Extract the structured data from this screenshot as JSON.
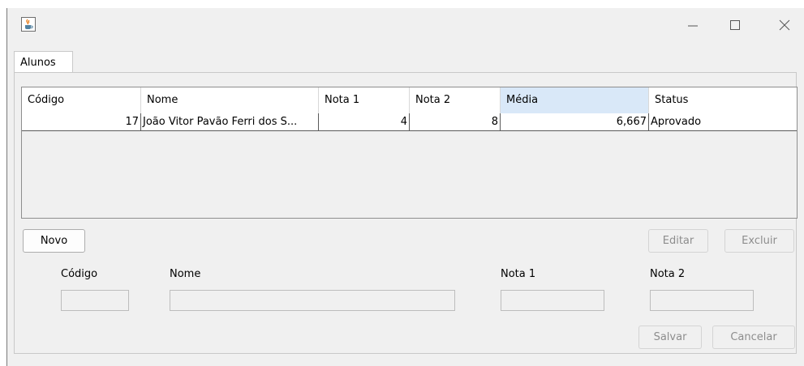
{
  "window": {
    "minimize_icon": "minimize-icon",
    "maximize_icon": "maximize-icon",
    "close_icon": "close-icon",
    "app_icon": "java-cup-icon"
  },
  "tabs": [
    {
      "label": "Alunos",
      "selected": true
    }
  ],
  "table": {
    "columns": [
      "Código",
      "Nome",
      "Nota 1",
      "Nota 2",
      "Média",
      "Status"
    ],
    "selected_column": "Média",
    "rows": [
      [
        "17",
        "João Vitor Pavão Ferri dos S...",
        "4",
        "8",
        "6,667",
        "Aprovado"
      ]
    ]
  },
  "buttons": {
    "novo": "Novo",
    "editar": "Editar",
    "excluir": "Excluir",
    "salvar": "Salvar",
    "cancelar": "Cancelar"
  },
  "form": {
    "codigo_label": "Código",
    "nome_label": "Nome",
    "nota1_label": "Nota 1",
    "nota2_label": "Nota 2",
    "codigo_value": "",
    "nome_value": "",
    "nota1_value": "",
    "nota2_value": ""
  },
  "colors": {
    "window_bg": "#f0f0f0",
    "selected_header": "#d9e8f8",
    "disabled_text": "#8d8d8d"
  }
}
